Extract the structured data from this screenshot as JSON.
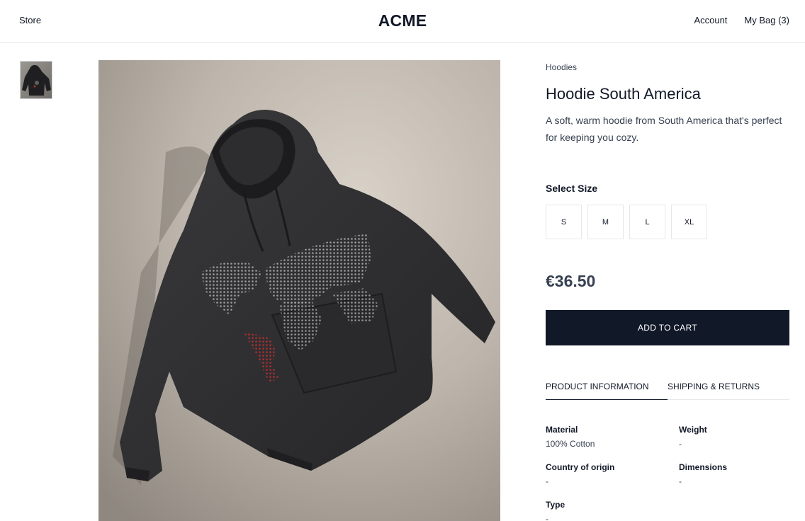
{
  "header": {
    "store_label": "Store",
    "brand": "ACME",
    "account_label": "Account",
    "bag_label": "My Bag (3)"
  },
  "product": {
    "category": "Hoodies",
    "title": "Hoodie South America",
    "description": "A soft, warm hoodie from South America that's perfect for keeping you cozy.",
    "size_label": "Select Size",
    "sizes": [
      "S",
      "M",
      "L",
      "XL"
    ],
    "price": "€36.50",
    "add_to_cart_label": "ADD TO CART"
  },
  "tabs": {
    "product_info": "PRODUCT INFORMATION",
    "shipping": "SHIPPING & RETURNS"
  },
  "specs": {
    "material_label": "Material",
    "material_value": "100% Cotton",
    "weight_label": "Weight",
    "weight_value": "-",
    "origin_label": "Country of origin",
    "origin_value": "-",
    "dimensions_label": "Dimensions",
    "dimensions_value": "-",
    "type_label": "Type",
    "type_value": "-"
  },
  "colors": {
    "primary": "#111827",
    "hoodie": "#2c2c2e",
    "highlight_region": "#b32d2e"
  }
}
